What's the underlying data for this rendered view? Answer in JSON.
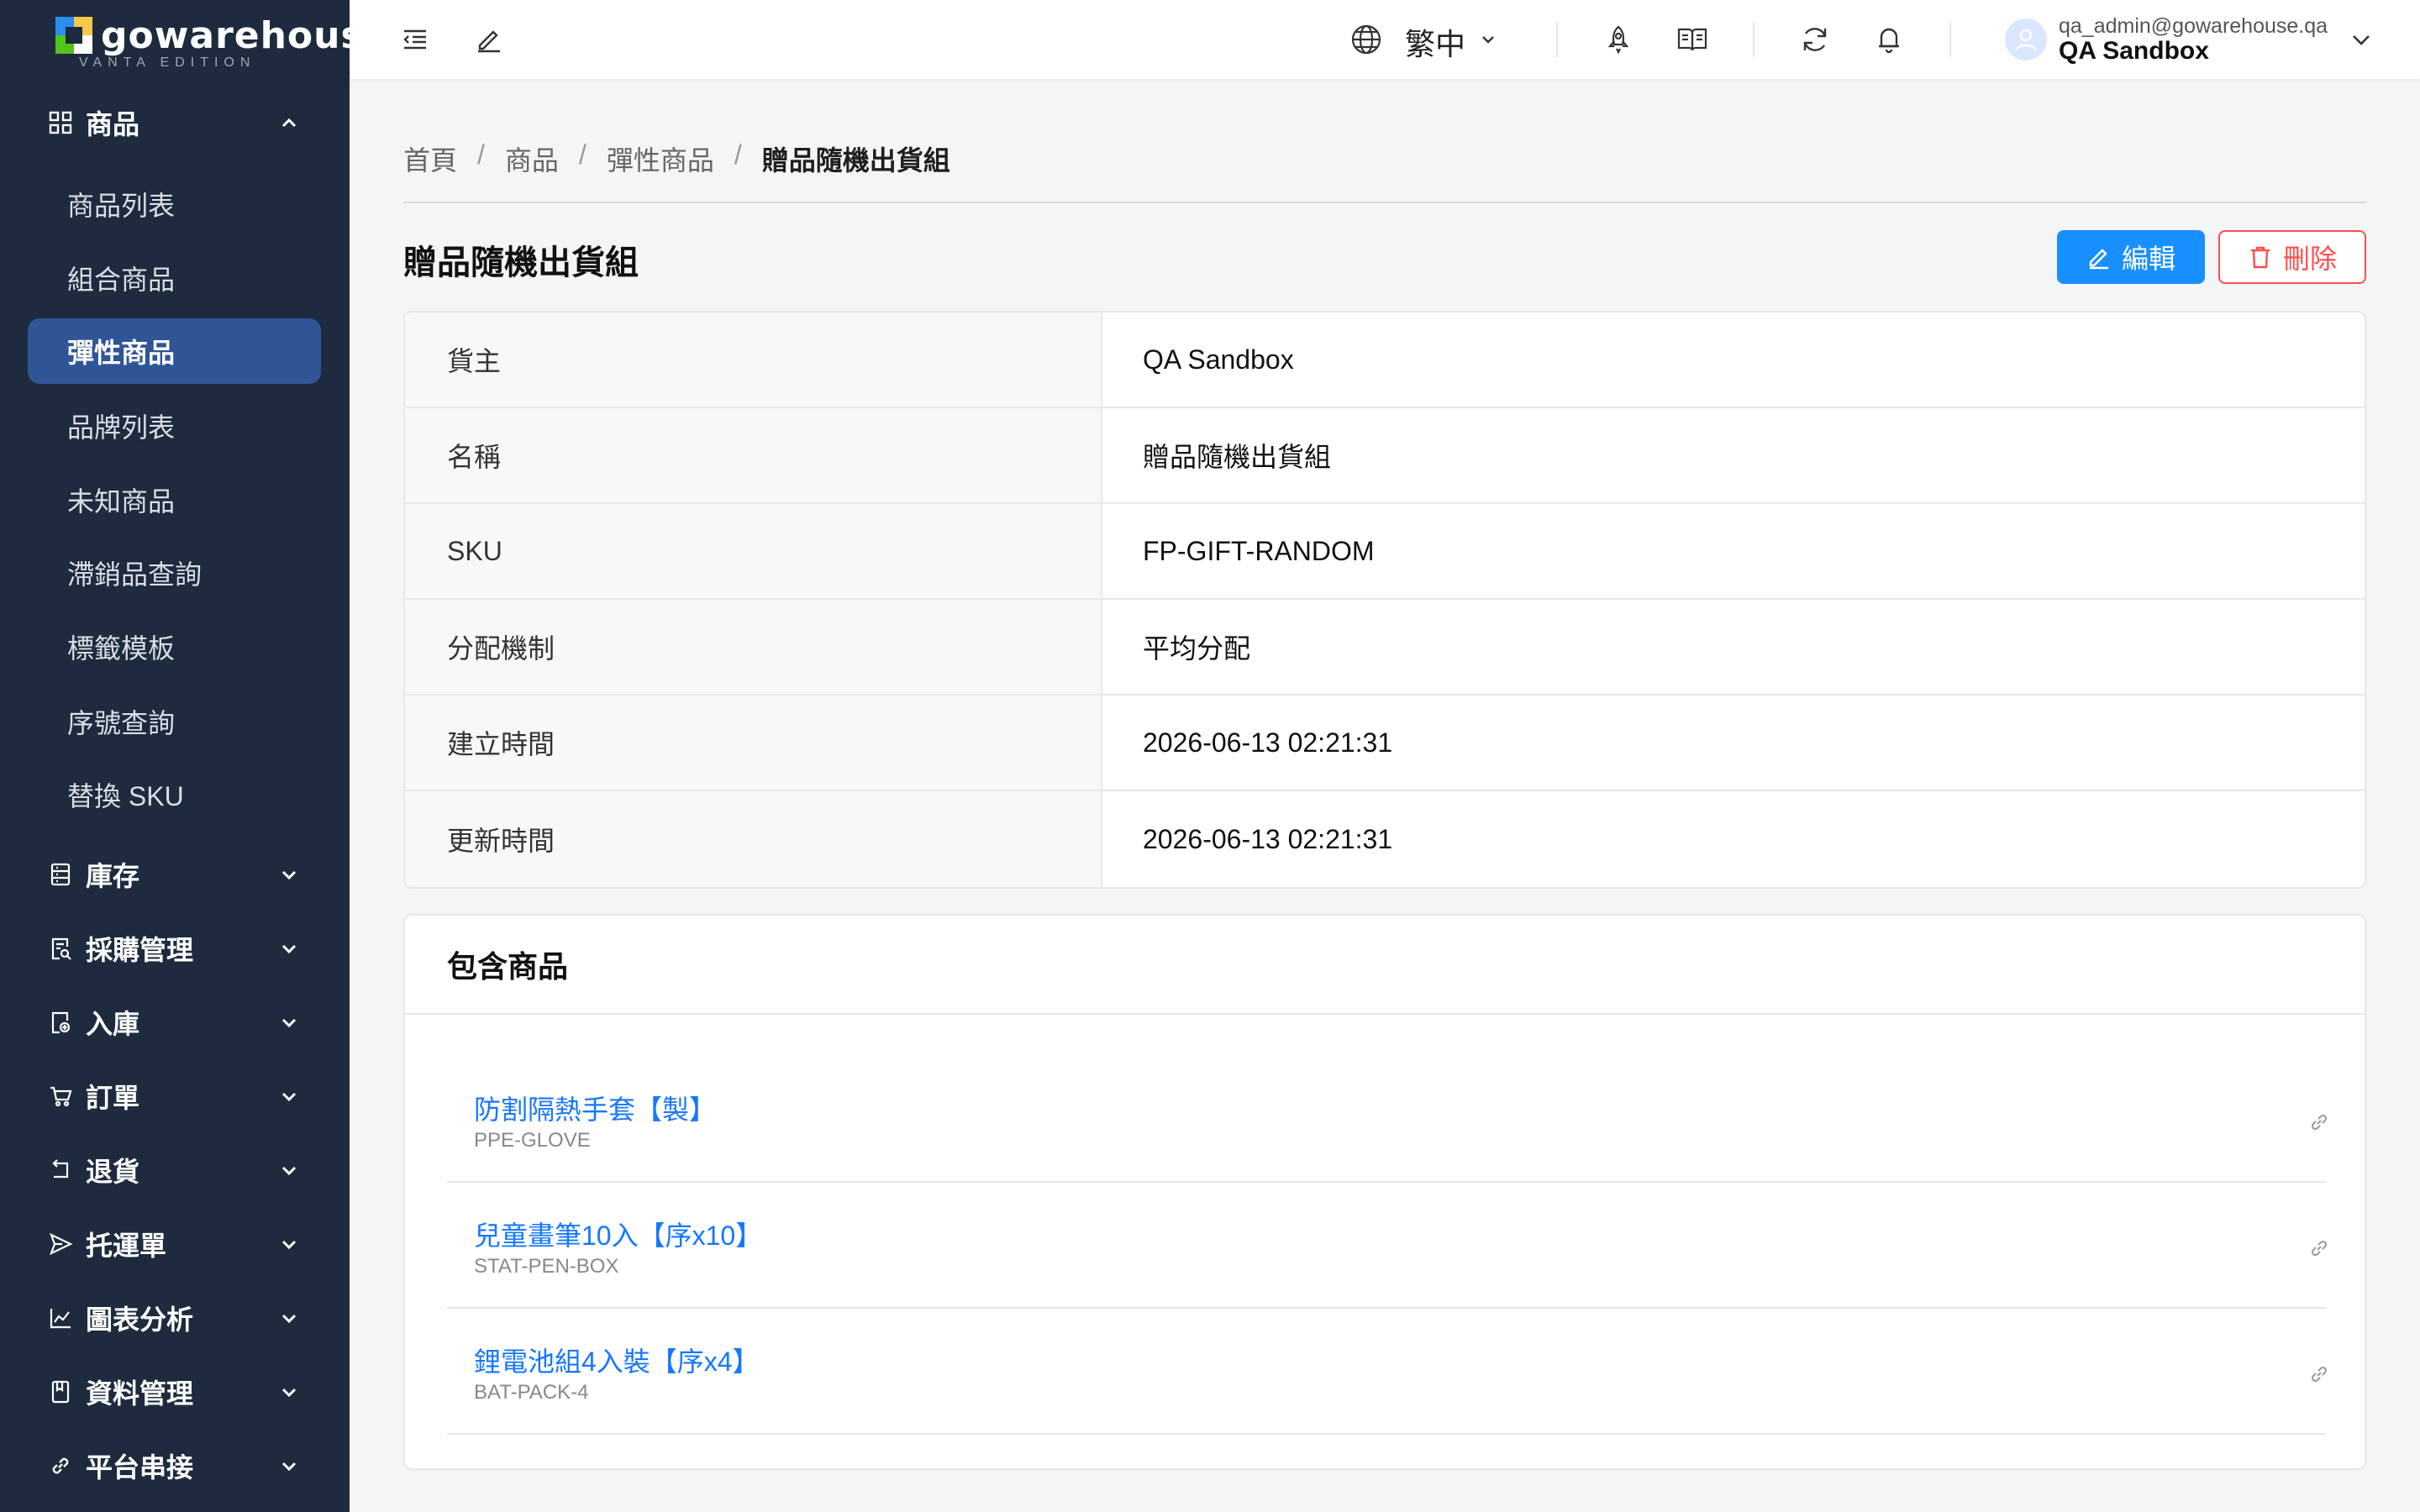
{
  "brand": {
    "name": "gowarehouse",
    "edition": "VANTA EDITION"
  },
  "sidebar": {
    "groups": [
      {
        "label": "商品",
        "icon": "grid-icon",
        "expanded": true
      },
      {
        "label": "庫存",
        "icon": "inventory-icon"
      },
      {
        "label": "採購管理",
        "icon": "purchase-icon"
      },
      {
        "label": "入庫",
        "icon": "inbound-icon"
      },
      {
        "label": "訂單",
        "icon": "cart-icon"
      },
      {
        "label": "退貨",
        "icon": "return-icon"
      },
      {
        "label": "托運單",
        "icon": "send-icon"
      },
      {
        "label": "圖表分析",
        "icon": "chart-icon"
      },
      {
        "label": "資料管理",
        "icon": "book-icon"
      },
      {
        "label": "平台串接",
        "icon": "link-icon"
      }
    ],
    "product_items": [
      "商品列表",
      "組合商品",
      "彈性商品",
      "品牌列表",
      "未知商品",
      "滯銷品查詢",
      "標籤模板",
      "序號查詢",
      "替換 SKU"
    ],
    "active_item": "彈性商品"
  },
  "header": {
    "language": "繁中",
    "user_email": "qa_admin@gowarehouse.qa",
    "user_org": "QA Sandbox"
  },
  "breadcrumb": [
    "首頁",
    "商品",
    "彈性商品",
    "贈品隨機出貨組"
  ],
  "page": {
    "title": "贈品隨機出貨組",
    "edit_label": "編輯",
    "delete_label": "刪除"
  },
  "details": [
    {
      "label": "貨主",
      "value": "QA Sandbox"
    },
    {
      "label": "名稱",
      "value": "贈品隨機出貨組"
    },
    {
      "label": "SKU",
      "value": "FP-GIFT-RANDOM"
    },
    {
      "label": "分配機制",
      "value": "平均分配"
    },
    {
      "label": "建立時間",
      "value": "2026-06-13 02:21:31"
    },
    {
      "label": "更新時間",
      "value": "2026-06-13 02:21:31"
    }
  ],
  "included": {
    "title": "包含商品",
    "items": [
      {
        "name": "防割隔熱手套【製】",
        "sku": "PPE-GLOVE"
      },
      {
        "name": "兒童畫筆10入【序x10】",
        "sku": "STAT-PEN-BOX"
      },
      {
        "name": "鋰電池組4入裝【序x4】",
        "sku": "BAT-PACK-4"
      }
    ]
  },
  "colors": {
    "sidebar": "#1e2b3e",
    "active": "#2f5597",
    "primary": "#1890ff",
    "danger": "#ff4d4f"
  }
}
